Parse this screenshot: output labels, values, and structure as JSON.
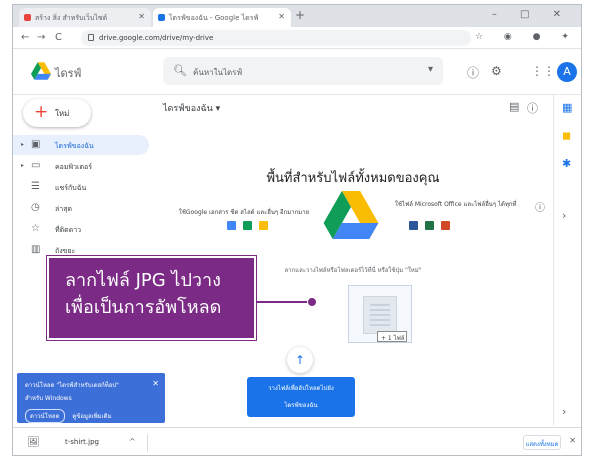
{
  "browser": {
    "tabs": [
      {
        "label": "สร้าง สิ่ง สำหรับเว็บไซต์",
        "favicon_color": "#e8453c"
      },
      {
        "label": "ไดรฟ์ของฉัน - Google ไดรฟ์",
        "favicon_color": "#1a73e8"
      }
    ],
    "new_tab": "+",
    "window_controls": "– □ ✕",
    "url": "drive.google.com/drive/my-drive",
    "nav_back": "←",
    "nav_forward": "→",
    "nav_reload": "C",
    "extensions": "☆ ◉ ● ✦"
  },
  "app": {
    "logo_text": "ไดรฟ์",
    "search_placeholder": "ค้นหาในไดรฟ์",
    "search_icon": "search-icon",
    "avatar_letter": "A"
  },
  "sidebar": {
    "new_label": "ใหม่",
    "items": [
      {
        "label": "ไดรฟ์ของฉัน",
        "icon": "▣",
        "arrow": "▸",
        "active": true
      },
      {
        "label": "คอมพิวเตอร์",
        "icon": "▭",
        "arrow": "▸",
        "active": false
      },
      {
        "label": "แชร์กับฉัน",
        "icon": "☰",
        "arrow": "",
        "active": false
      },
      {
        "label": "ล่าสุด",
        "icon": "◷",
        "arrow": "",
        "active": false
      },
      {
        "label": "ที่ติดดาว",
        "icon": "☆",
        "arrow": "",
        "active": false
      },
      {
        "label": "ถังขยะ",
        "icon": "▥",
        "arrow": "",
        "active": false
      }
    ]
  },
  "main": {
    "breadcrumb": "ไดรฟ์ของฉัน ▾",
    "empty_title": "พื้นที่สำหรับไฟล์ทั้งหมดของคุณ",
    "left_desc": "ใช้Google เอกสาร ชีต สไลด์ และอื่นๆ อีกมากมาย",
    "right_desc": "ใช้ไฟล์ Microsoft Office และไฟล์อื่นๆ ได้ทุกที่",
    "drop_message": "ลากและวางไฟล์หรือโฟลเดอร์ไว้ที่นี่ หรือใช้ปุ่ม \"ใหม่\"",
    "drag_badge": "+ 1 ไฟล์",
    "upload_card_line1": "วางไฟล์เพื่ออัปโหลดไปยัง",
    "upload_card_line2": "ไดรฟ์ของฉัน"
  },
  "toast": {
    "line1": "ดาวน์โหลด \"ไดรฟ์สำหรับเดสก์ท็อป\"",
    "line2": "สำหรับ Windows",
    "button_primary": "ดาวน์โหลด",
    "button_secondary": "ดูข้อมูลเพิ่มเติม",
    "close": "✕"
  },
  "download_bar": {
    "filename": "t-shirt.jpg",
    "chevron": "^",
    "show_all": "แสดงทั้งหมด",
    "close": "✕"
  },
  "callout": {
    "line1": "ลากไฟล์ JPG ไปวาง",
    "line2": "เพื่อเป็นการอัพโหลด",
    "color": "#7b2a86"
  }
}
